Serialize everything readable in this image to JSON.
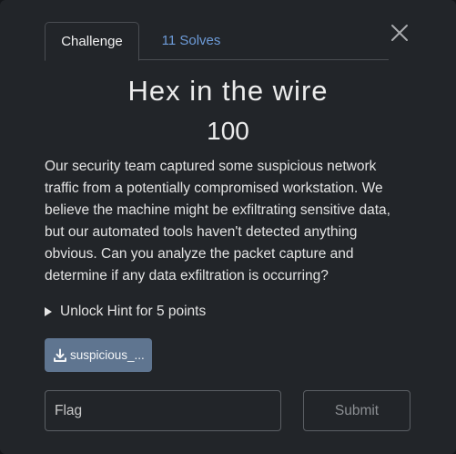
{
  "tabs": {
    "challenge": "Challenge",
    "solves": "11 Solves"
  },
  "challenge": {
    "name": "Hex in the wire",
    "points": "100",
    "description": "Our security team captured some suspicious network traffic from a potentially compromised workstation. We believe the machine might be exfiltrating sensitive data, but our automated tools haven't detected anything obvious. Can you analyze the packet capture and determine if any data exfiltration is occurring?"
  },
  "hint": {
    "label": "Unlock Hint for 5 points"
  },
  "file": {
    "label": "suspicious_...",
    "icon": "download-icon"
  },
  "form": {
    "flag_placeholder": "Flag",
    "submit_label": "Submit"
  },
  "colors": {
    "background": "#222529",
    "accent_link": "#6d9bd8",
    "file_button": "#5f7590"
  }
}
